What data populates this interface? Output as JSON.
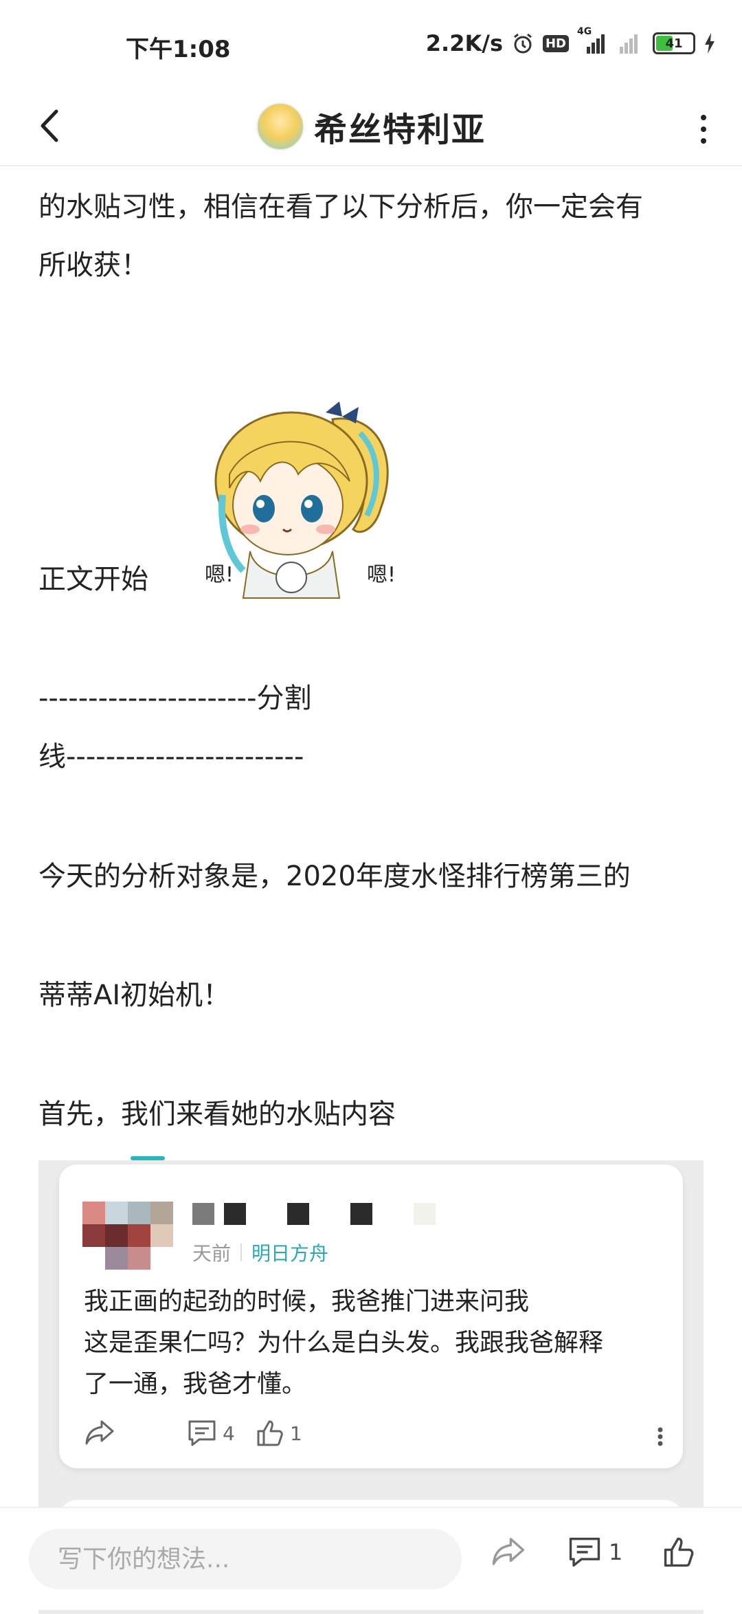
{
  "status_bar": {
    "time": "下午1:08",
    "speed": "2.2K/s",
    "hd": "HD",
    "network": "4G",
    "battery": "41"
  },
  "header": {
    "title": "希丝特利亚"
  },
  "article": {
    "line1": "的水贴习性，相信在看了以下分析后，你一定会有",
    "line2": "所收获！",
    "line3": "正文开始",
    "divider_a": "----------------------分割",
    "divider_b": "线------------------------",
    "line4": "今天的分析对象是，2020年度水怪排行榜第三的",
    "line5": "蒂蒂AI初始机！",
    "line6": "首先，我们来看她的水贴内容"
  },
  "sticker": {
    "text_left": "嗯!",
    "text_right": "嗯!"
  },
  "embedded_post": {
    "time": "天前",
    "tag": "明日方舟",
    "body_line1": "我正画的起劲的时候，我爸推门进来问我",
    "body_line2": "这是歪果仁吗？为什么是白头发。我跟我爸解释",
    "body_line3": "了一通，我爸才懂。",
    "comment_count": "4",
    "like_count": "1"
  },
  "bottom_bar": {
    "input_placeholder": "写下你的想法...",
    "comment_count": "1"
  },
  "colors": {
    "accent": "#27aab5",
    "text": "#222222",
    "muted": "#999999"
  }
}
